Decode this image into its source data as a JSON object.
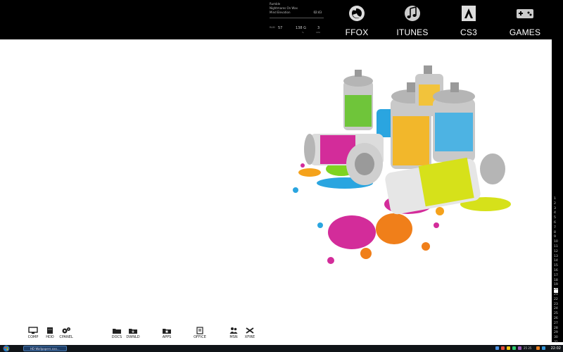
{
  "now_playing": {
    "lines": [
      "Rumble",
      "Nightmares On Wax",
      "Mind Elevation"
    ],
    "time": "02:43"
  },
  "stats": [
    {
      "label": "RAM",
      "value": "57"
    },
    {
      "label": "",
      "value": "138 G",
      "sub": "%"
    },
    {
      "label": "",
      "value": "3",
      "sub": "CPU"
    }
  ],
  "launchers": [
    {
      "label": "FFOX",
      "icon": "firefox-icon"
    },
    {
      "label": "ITUNES",
      "icon": "itunes-music-icon"
    },
    {
      "label": "CS3",
      "icon": "adobe-icon"
    },
    {
      "label": "GAMES",
      "icon": "gamepad-icon"
    }
  ],
  "calendar_days": [
    "1",
    "2",
    "3",
    "4",
    "5",
    "6",
    "7",
    "8",
    "9",
    "10",
    "11",
    "12",
    "13",
    "14",
    "15",
    "16",
    "17",
    "18",
    "19",
    "20",
    "21",
    "22",
    "23",
    "24",
    "25",
    "26",
    "27",
    "28",
    "29",
    "30",
    "31"
  ],
  "calendar_today": "20",
  "desktop_icons": [
    {
      "label": "COMP",
      "icon": "monitor-icon"
    },
    {
      "label": "HDD",
      "icon": "hard-drive-icon"
    },
    {
      "label": "CPANEL",
      "icon": "gears-icon"
    },
    {
      "label": "DOCS",
      "icon": "folder-icon"
    },
    {
      "label": "DWNLD",
      "icon": "folder-download-icon"
    },
    {
      "label": "APPS",
      "icon": "folder-apps-icon"
    },
    {
      "label": "OFFICE",
      "icon": "office-document-icon"
    },
    {
      "label": "MSN",
      "icon": "msn-people-icon"
    },
    {
      "label": "XFIRE",
      "icon": "xfire-icon"
    }
  ],
  "taskbar": {
    "task_label": "HD Wallpapers.xxx...",
    "tray_text": "25 25",
    "clock": "22:02"
  },
  "colors": {
    "accent_blue": "#2b6fb8",
    "bar": "#000000"
  }
}
